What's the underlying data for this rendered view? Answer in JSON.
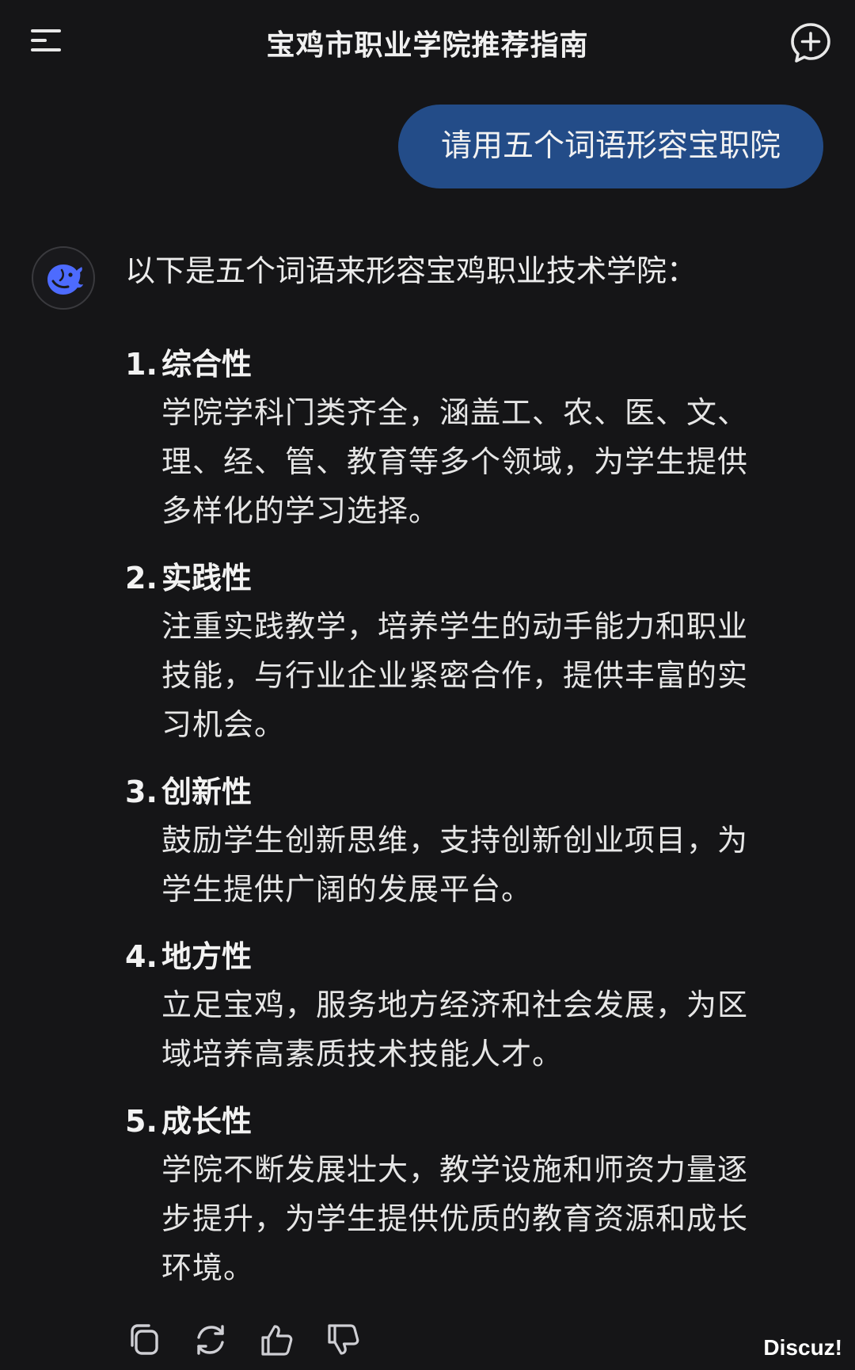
{
  "header": {
    "title": "宝鸡市职业学院推荐指南",
    "menu_icon": "menu-icon",
    "new_chat_icon": "new-chat-icon"
  },
  "user_message": {
    "text": "请用五个词语形容宝职院"
  },
  "assistant_message": {
    "avatar_icon": "deepseek-whale-icon",
    "intro": "以下是五个词语来形容宝鸡职业技术学院：",
    "items": [
      {
        "number": "1.",
        "title": "综合性",
        "lines": [
          "学院学科门类齐全，涵盖工、农、医、文、",
          "理、经、管、教育等多个领域，为学生提供",
          "多样化的学习选择。"
        ]
      },
      {
        "number": "2.",
        "title": "实践性",
        "lines": [
          "注重实践教学，培养学生的动手能力和职业",
          "技能，与行业企业紧密合作，提供丰富的实",
          "习机会。"
        ]
      },
      {
        "number": "3.",
        "title": "创新性",
        "lines": [
          "鼓励学生创新思维，支持创新创业项目，为",
          "学生提供广阔的发展平台。"
        ]
      },
      {
        "number": "4.",
        "title": "地方性",
        "lines": [
          "立足宝鸡，服务地方经济和社会发展，为区",
          "域培养高素质技术技能人才。"
        ]
      },
      {
        "number": "5.",
        "title": "成长性",
        "lines": [
          "学院不断发展壮大，教学设施和师资力量逐",
          "步提升，为学生提供优质的教育资源和成长",
          "环境。"
        ]
      }
    ]
  },
  "actions": [
    "copy-icon",
    "regenerate-icon",
    "thumbs-up-icon",
    "thumbs-down-icon"
  ],
  "watermark": "Discuz!",
  "colors": {
    "background": "#151517",
    "user_bubble": "#234c88",
    "avatar_accent": "#4d6bfe"
  }
}
